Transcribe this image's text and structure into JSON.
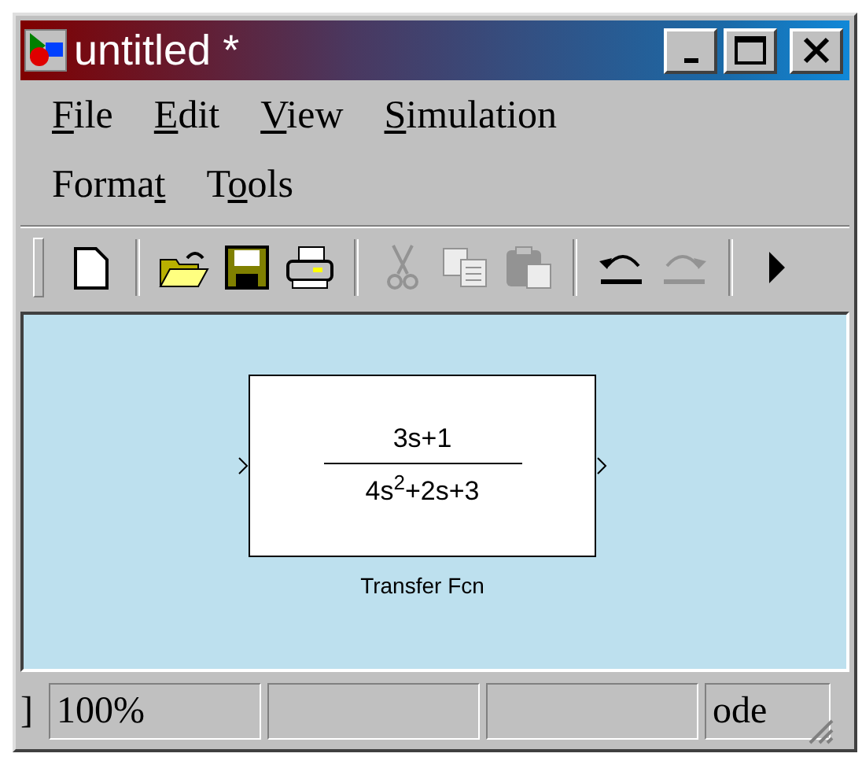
{
  "window": {
    "title": "untitled *"
  },
  "menu_rows": [
    [
      {
        "key": "F",
        "after": "ile"
      },
      {
        "key": "E",
        "after": "dit"
      },
      {
        "key": "V",
        "after": "iew"
      },
      {
        "key": "S",
        "after": "imulation"
      }
    ],
    [
      {
        "before": "Forma",
        "key": "t"
      },
      {
        "before": "T",
        "key": "o",
        "after": "ols"
      }
    ]
  ],
  "toolbar": {
    "groups": [
      [
        {
          "kind": "new",
          "disabled": false
        }
      ],
      [
        {
          "kind": "open",
          "disabled": false
        },
        {
          "kind": "save",
          "disabled": false
        },
        {
          "kind": "print",
          "disabled": false
        }
      ],
      [
        {
          "kind": "cut",
          "disabled": true
        },
        {
          "kind": "copy",
          "disabled": true
        },
        {
          "kind": "paste",
          "disabled": true
        }
      ],
      [
        {
          "kind": "undo",
          "disabled": false
        },
        {
          "kind": "redo",
          "disabled": true
        }
      ]
    ]
  },
  "block": {
    "numerator": "3s+1",
    "denominator": "4s$^{2}$+2s+3",
    "name": "Transfer Fcn"
  },
  "status_bar": {
    "cells": [
      "]",
      "100%",
      "",
      "",
      "ode"
    ]
  }
}
